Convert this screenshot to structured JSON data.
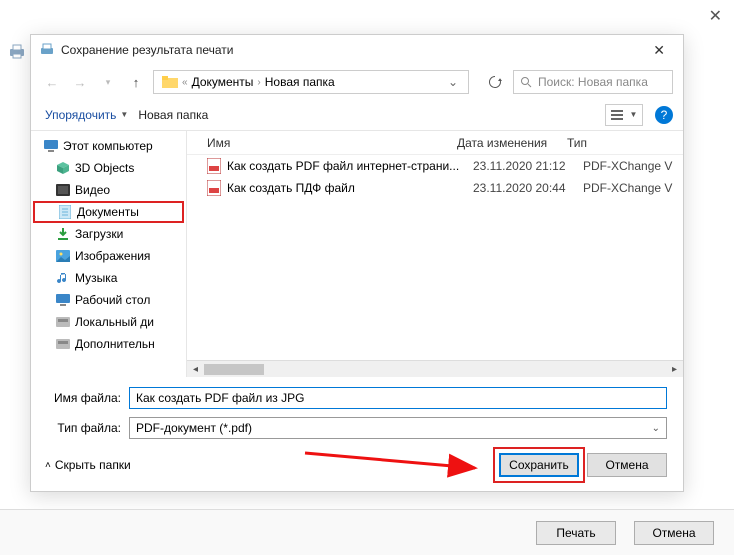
{
  "top_close": "✕",
  "dialog": {
    "title": "Сохранение результата печати",
    "close": "✕"
  },
  "breadcrumb": {
    "seg1": "Документы",
    "seg2": "Новая папка"
  },
  "search": {
    "placeholder": "Поиск: Новая папка"
  },
  "toolbar": {
    "organize": "Упорядочить",
    "newfolder": "Новая папка"
  },
  "tree": {
    "this_pc": "Этот компьютер",
    "objects3d": "3D Objects",
    "videos": "Видео",
    "documents": "Документы",
    "downloads": "Загрузки",
    "pictures": "Изображения",
    "music": "Музыка",
    "desktop": "Рабочий стол",
    "localdisk": "Локальный ди",
    "extra": "Дополнительн"
  },
  "file_columns": {
    "name": "Имя",
    "date": "Дата изменения",
    "type": "Тип"
  },
  "files": [
    {
      "name": "Как создать PDF файл интернет-страни...",
      "date": "23.11.2020 21:12",
      "type": "PDF-XChange V"
    },
    {
      "name": "Как создать ПДФ файл",
      "date": "23.11.2020 20:44",
      "type": "PDF-XChange V"
    }
  ],
  "form": {
    "name_label": "Имя файла:",
    "name_value": "Как создать PDF файл из JPG",
    "type_label": "Тип файла:",
    "type_value": "PDF-документ (*.pdf)"
  },
  "footer": {
    "hide": "Скрыть папки",
    "save": "Сохранить",
    "cancel": "Отмена"
  },
  "bottom": {
    "print": "Печать",
    "cancel": "Отмена"
  }
}
